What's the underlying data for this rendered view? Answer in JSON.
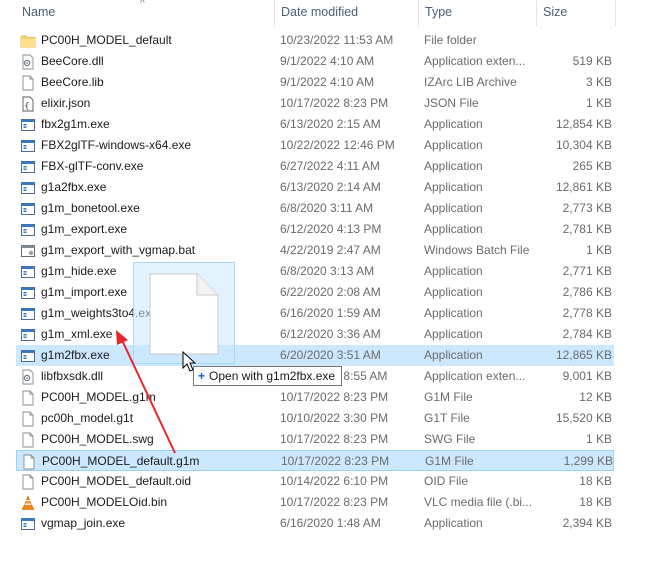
{
  "columns": {
    "name": "Name",
    "date": "Date modified",
    "type": "Type",
    "size": "Size"
  },
  "files": [
    {
      "name": "PC00H_MODEL_default",
      "date": "10/23/2022 11:53 AM",
      "type": "File folder",
      "size": "",
      "icon": "folder-icon"
    },
    {
      "name": "BeeCore.dll",
      "date": "9/1/2022 4:10 AM",
      "type": "Application exten...",
      "size": "519 KB",
      "icon": "dll-icon"
    },
    {
      "name": "BeeCore.lib",
      "date": "9/1/2022 4:10 AM",
      "type": "IZArc LIB Archive",
      "size": "3 KB",
      "icon": "file-icon"
    },
    {
      "name": "elixir.json",
      "date": "10/17/2022 8:23 PM",
      "type": "JSON File",
      "size": "1 KB",
      "icon": "json-icon"
    },
    {
      "name": "fbx2g1m.exe",
      "date": "6/13/2020 2:15 AM",
      "type": "Application",
      "size": "12,854 KB",
      "icon": "exe-icon"
    },
    {
      "name": "FBX2glTF-windows-x64.exe",
      "date": "10/22/2022 12:46 PM",
      "type": "Application",
      "size": "10,304 KB",
      "icon": "exe-icon"
    },
    {
      "name": "FBX-glTF-conv.exe",
      "date": "6/27/2022 4:11 AM",
      "type": "Application",
      "size": "265 KB",
      "icon": "exe-icon"
    },
    {
      "name": "g1a2fbx.exe",
      "date": "6/13/2020 2:14 AM",
      "type": "Application",
      "size": "12,861 KB",
      "icon": "exe-icon"
    },
    {
      "name": "g1m_bonetool.exe",
      "date": "6/8/2020 3:11 AM",
      "type": "Application",
      "size": "2,773 KB",
      "icon": "exe-icon"
    },
    {
      "name": "g1m_export.exe",
      "date": "6/12/2020 4:13 PM",
      "type": "Application",
      "size": "2,781 KB",
      "icon": "exe-icon"
    },
    {
      "name": "g1m_export_with_vgmap.bat",
      "date": "4/22/2019 2:47 AM",
      "type": "Windows Batch File",
      "size": "1 KB",
      "icon": "bat-icon"
    },
    {
      "name": "g1m_hide.exe",
      "date": "6/8/2020 3:13 AM",
      "type": "Application",
      "size": "2,771 KB",
      "icon": "exe-icon"
    },
    {
      "name": "g1m_import.exe",
      "date": "6/22/2020 2:08 AM",
      "type": "Application",
      "size": "2,786 KB",
      "icon": "exe-icon"
    },
    {
      "name": "g1m_weights3to4.exe",
      "date": "6/16/2020 1:59 AM",
      "type": "Application",
      "size": "2,778 KB",
      "icon": "exe-icon"
    },
    {
      "name": "g1m_xml.exe",
      "date": "6/12/2020 3:36 AM",
      "type": "Application",
      "size": "2,784 KB",
      "icon": "exe-icon"
    },
    {
      "name": "g1m2fbx.exe",
      "date": "6/20/2020 3:51 AM",
      "type": "Application",
      "size": "12,865 KB",
      "icon": "exe-icon",
      "state": "hover"
    },
    {
      "name": "libfbxsdk.dll",
      "date": "10/17/2022 8:55 AM",
      "type": "Application exten...",
      "size": "9,001 KB",
      "icon": "dll-icon"
    },
    {
      "name": "PC00H_MODEL.g1m",
      "date": "10/17/2022 8:23 PM",
      "type": "G1M File",
      "size": "12 KB",
      "icon": "file-icon"
    },
    {
      "name": "pc00h_model.g1t",
      "date": "10/10/2022 3:30 PM",
      "type": "G1T File",
      "size": "15,520 KB",
      "icon": "file-icon"
    },
    {
      "name": "PC00H_MODEL.swg",
      "date": "10/17/2022 8:23 PM",
      "type": "SWG File",
      "size": "1 KB",
      "icon": "file-icon"
    },
    {
      "name": "PC00H_MODEL_default.g1m",
      "date": "10/17/2022 8:23 PM",
      "type": "G1M File",
      "size": "1,299 KB",
      "icon": "file-icon",
      "state": "selected"
    },
    {
      "name": "PC00H_MODEL_default.oid",
      "date": "10/14/2022 6:10 PM",
      "type": "OID File",
      "size": "18 KB",
      "icon": "file-icon"
    },
    {
      "name": "PC00H_MODELOid.bin",
      "date": "10/17/2022 8:23 PM",
      "type": "VLC media file (.bi...",
      "size": "18 KB",
      "icon": "vlc-icon"
    },
    {
      "name": "vgmap_join.exe",
      "date": "6/16/2020 1:48 AM",
      "type": "Application",
      "size": "2,394 KB",
      "icon": "exe-icon"
    }
  ],
  "drag_tooltip": {
    "plus": "+",
    "text": "Open with g1m2fbx.exe"
  },
  "colors": {
    "accent": "#cce8ff",
    "selection_border": "#99d1ff",
    "arrow": "#e8262d"
  }
}
